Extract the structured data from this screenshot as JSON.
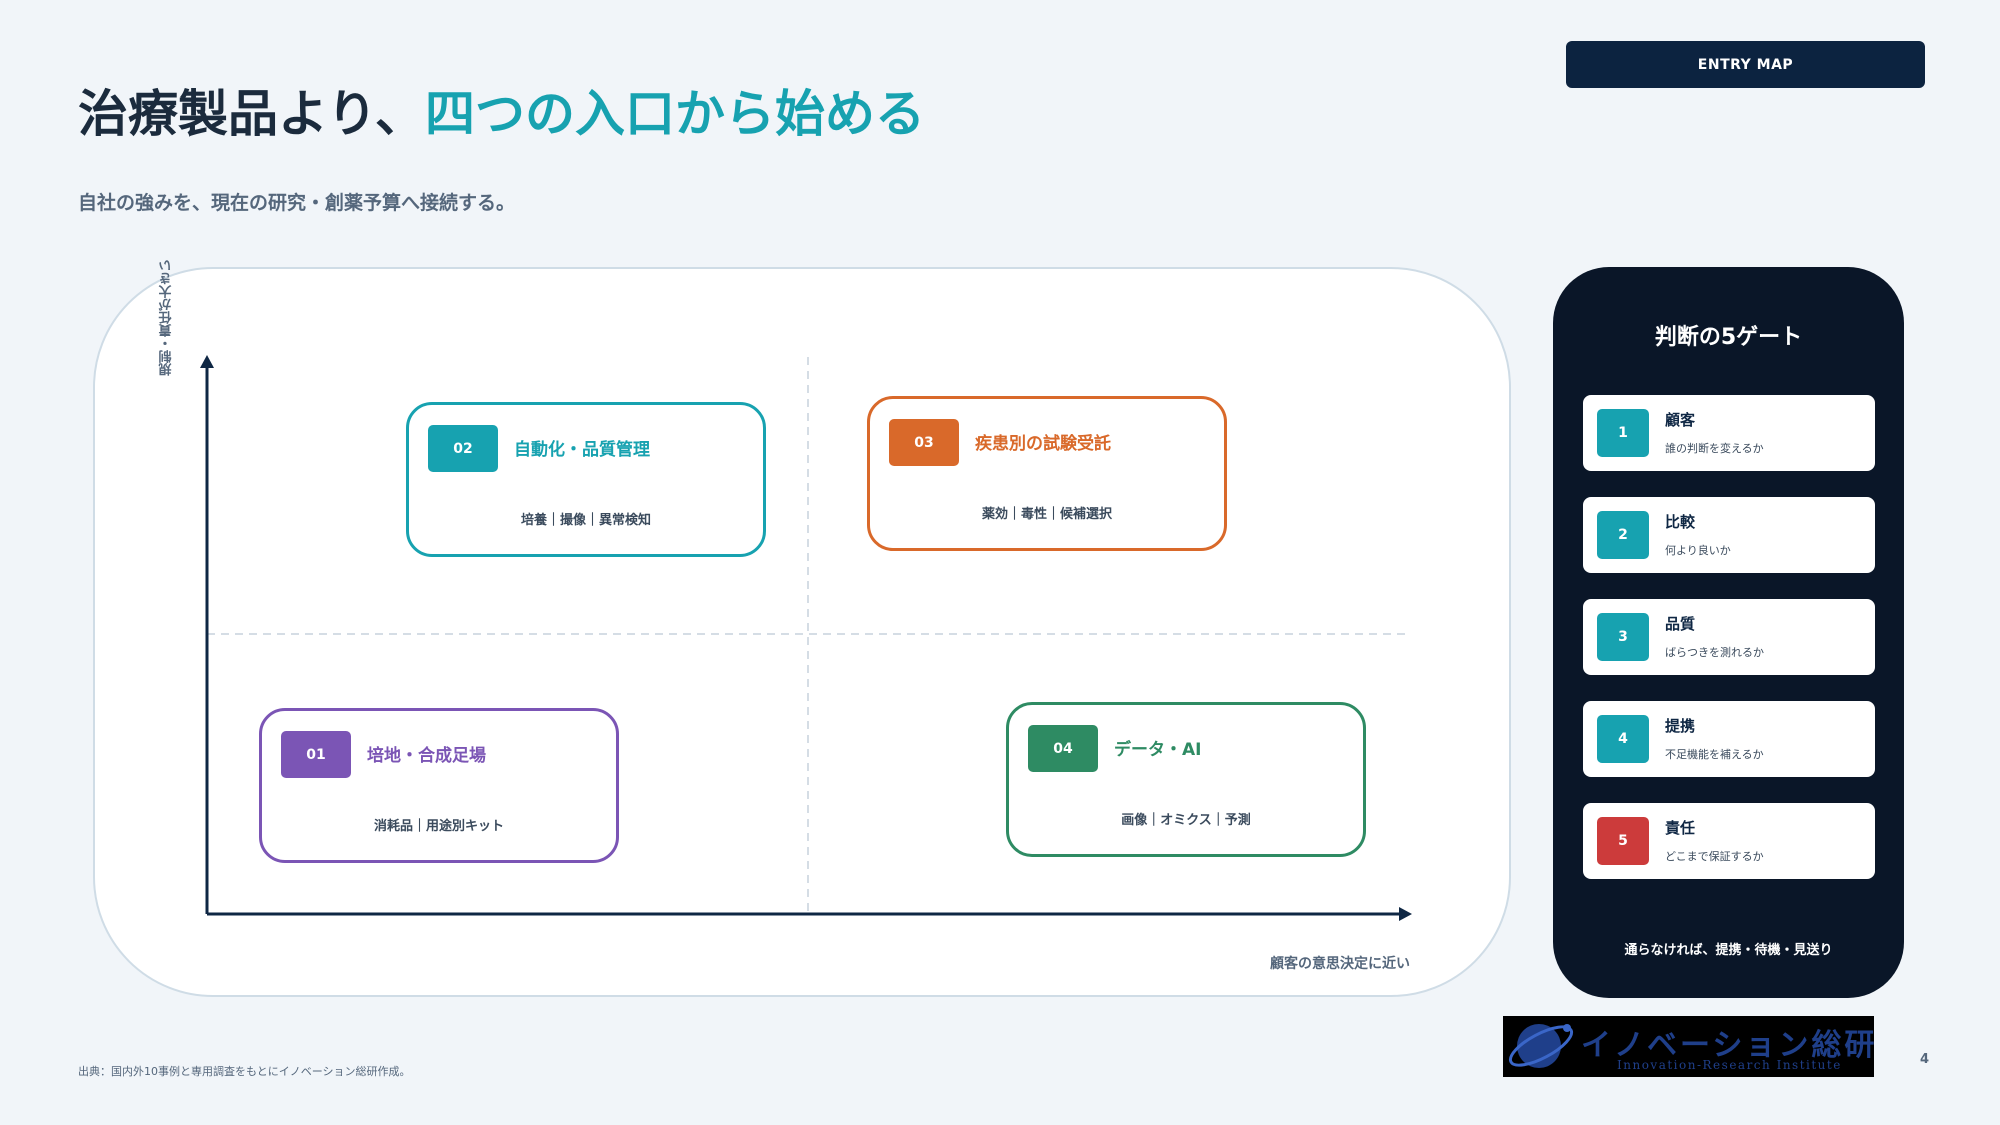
{
  "header": {
    "badge": "ENTRY MAP",
    "title_main": "治療製品より、",
    "title_accent": "四つの入口から始める",
    "subtitle": "自社の強みを、現在の研究・創薬予算へ接続する。"
  },
  "map": {
    "y_axis_label": "規制・責任が大きい",
    "x_axis_label": "顧客の意思決定に近い",
    "cards": [
      {
        "num": "02",
        "name": "自動化・品質管理",
        "tags": "培養｜撮像｜異常検知",
        "color": "#17a2b0"
      },
      {
        "num": "03",
        "name": "疾患別の試験受託",
        "tags": "薬効｜毒性｜候補選択",
        "color": "#d9692a"
      },
      {
        "num": "01",
        "name": "培地・合成足場",
        "tags": "消耗品｜用途別キット",
        "color": "#7b55b5"
      },
      {
        "num": "04",
        "name": "データ・AI",
        "tags": "画像｜オミクス｜予測",
        "color": "#2e8b63"
      }
    ]
  },
  "gates": {
    "title": "判断の5ゲート",
    "items": [
      {
        "num": "1",
        "name": "顧客",
        "desc": "誰の判断を変えるか",
        "color": "#17a2b0"
      },
      {
        "num": "2",
        "name": "比較",
        "desc": "何より良いか",
        "color": "#17a2b0"
      },
      {
        "num": "3",
        "name": "品質",
        "desc": "ばらつきを測れるか",
        "color": "#17a2b0"
      },
      {
        "num": "4",
        "name": "提携",
        "desc": "不足機能を補えるか",
        "color": "#17a2b0"
      },
      {
        "num": "5",
        "name": "責任",
        "desc": "どこまで保証するか",
        "color": "#cc3b3b"
      }
    ],
    "footer": "通らなければ、提携・待機・見送り"
  },
  "footer": {
    "source": "出典：国内外10事例と専用調査をもとにイノベーション総研作成。",
    "logo_jp": "イノベーション総研",
    "logo_en": "Innovation-Research Institute",
    "page_number": "4"
  }
}
